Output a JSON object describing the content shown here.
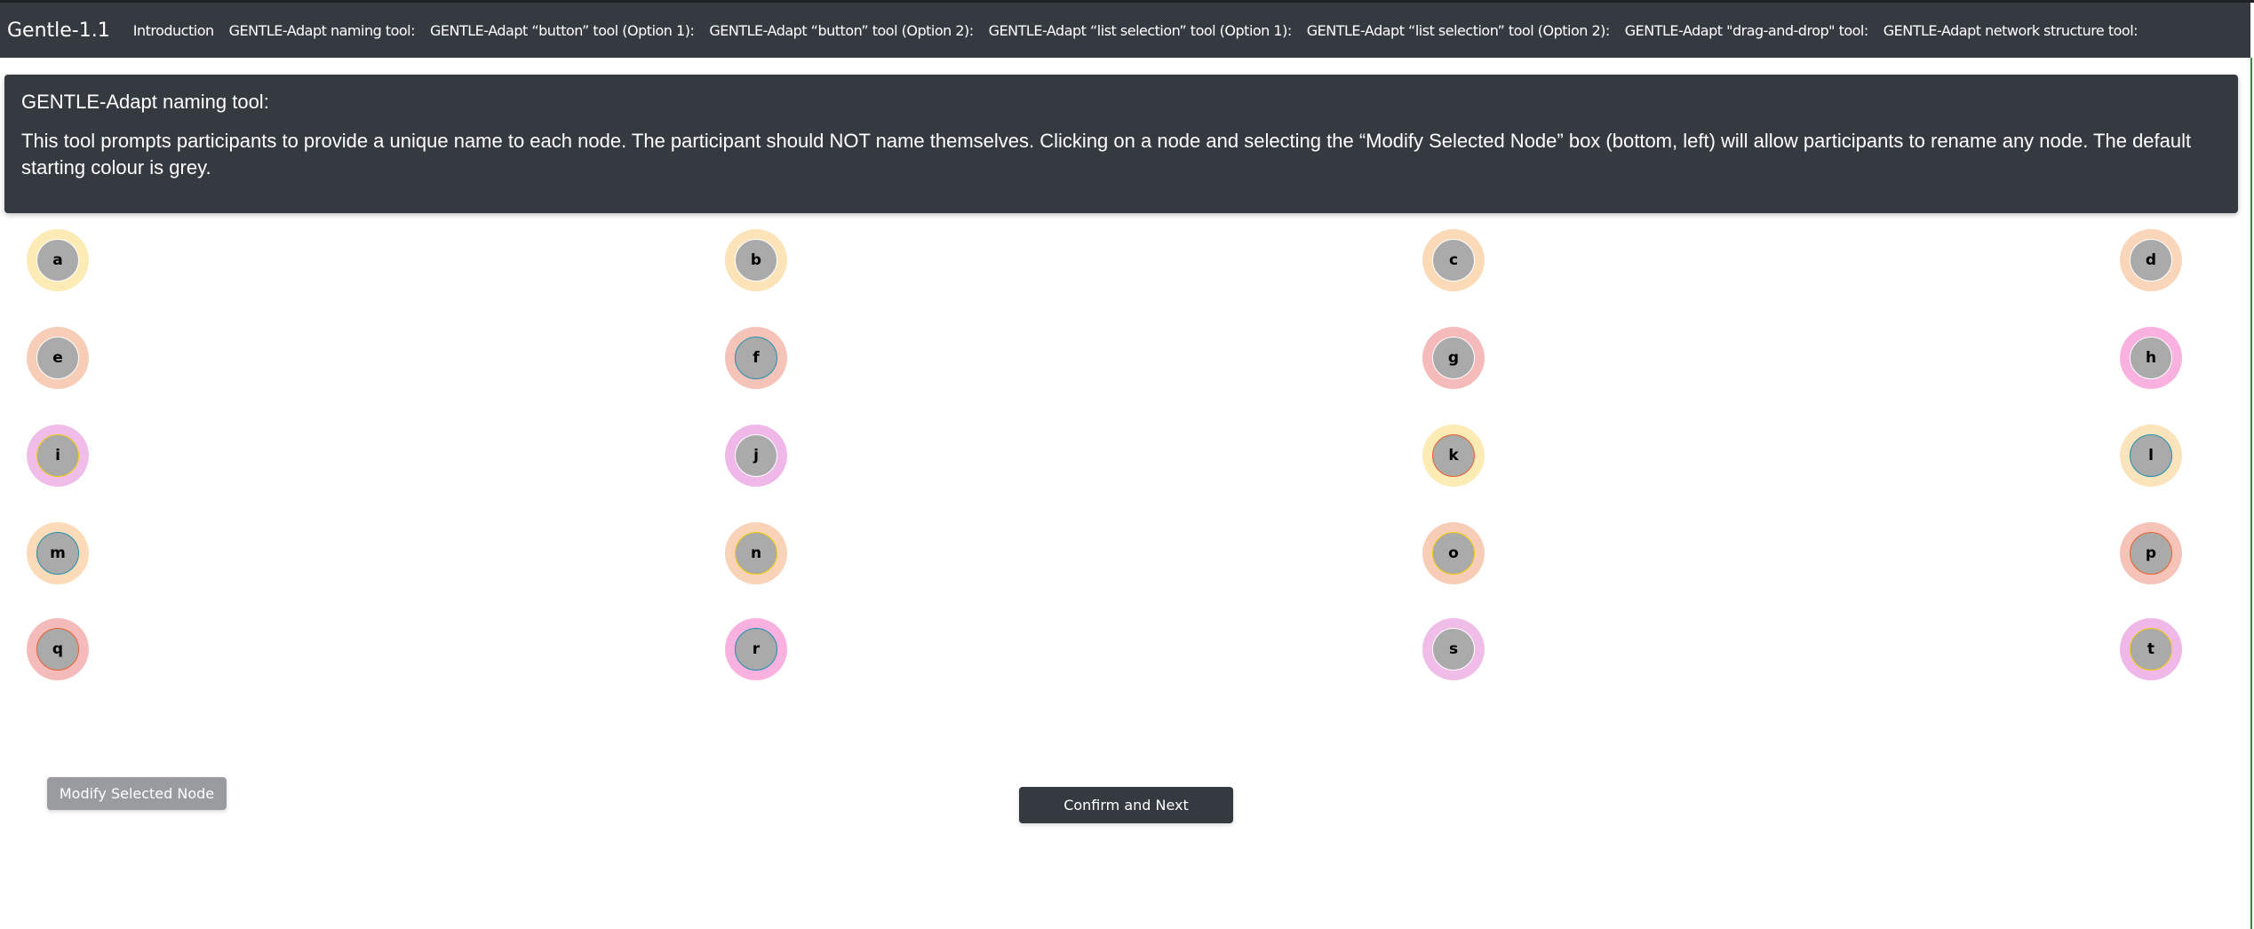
{
  "nav": {
    "brand": "Gentle-1.1",
    "links": [
      "Introduction",
      "GENTLE-Adapt naming tool:",
      "GENTLE-Adapt “button” tool (Option 1):",
      "GENTLE-Adapt “button” tool (Option 2):",
      "GENTLE-Adapt “list selection” tool (Option 1):",
      "GENTLE-Adapt “list selection” tool (Option 2):",
      "GENTLE-Adapt \"drag-and-drop\" tool:",
      "GENTLE-Adapt network structure tool:"
    ]
  },
  "card": {
    "title": "GENTLE-Adapt naming tool:",
    "body": "This tool prompts participants to provide a unique name to each node. The participant should NOT name themselves. Clicking on a node and selecting the “Modify Selected Node” box (bottom, left) will allow participants to rename any node. The default starting colour is grey."
  },
  "nodes": [
    {
      "label": "a",
      "ring": "#fdebb5",
      "border": "#ffffff"
    },
    {
      "label": "b",
      "ring": "#fde3b8",
      "border": "#ffffff"
    },
    {
      "label": "c",
      "ring": "#fbdab8",
      "border": "#ffffff"
    },
    {
      "label": "d",
      "ring": "#f9d6b9",
      "border": "#ffffff"
    },
    {
      "label": "e",
      "ring": "#f7cdb8",
      "border": "#ffffff"
    },
    {
      "label": "f",
      "ring": "#f6c3b8",
      "border": "#1e90b0"
    },
    {
      "label": "g",
      "ring": "#f5bbbb",
      "border": "#ffffff"
    },
    {
      "label": "h",
      "ring": "#f9b2e0",
      "border": "#ffffff"
    },
    {
      "label": "i",
      "ring": "#efbde8",
      "border": "#f0d000"
    },
    {
      "label": "j",
      "ring": "#efb8e8",
      "border": "#ffffff"
    },
    {
      "label": "k",
      "ring": "#fdebb5",
      "border": "#e8602c"
    },
    {
      "label": "l",
      "ring": "#fbe3bb",
      "border": "#1e90b0"
    },
    {
      "label": "m",
      "ring": "#fbdbb8",
      "border": "#1e90b0"
    },
    {
      "label": "n",
      "ring": "#f8d3b8",
      "border": "#f0d000"
    },
    {
      "label": "o",
      "ring": "#f7cdb8",
      "border": "#f0d000"
    },
    {
      "label": "p",
      "ring": "#f6c3b8",
      "border": "#e8602c"
    },
    {
      "label": "q",
      "ring": "#f5bbbb",
      "border": "#e8602c"
    },
    {
      "label": "r",
      "ring": "#f9b2e0",
      "border": "#1e90b0"
    },
    {
      "label": "s",
      "ring": "#efbde8",
      "border": "#ffffff"
    },
    {
      "label": "t",
      "ring": "#efb8e8",
      "border": "#f0d000"
    }
  ],
  "node_fill": "#aaaaaa",
  "buttons": {
    "modify": "Modify Selected Node",
    "confirm": "Confirm and Next"
  }
}
